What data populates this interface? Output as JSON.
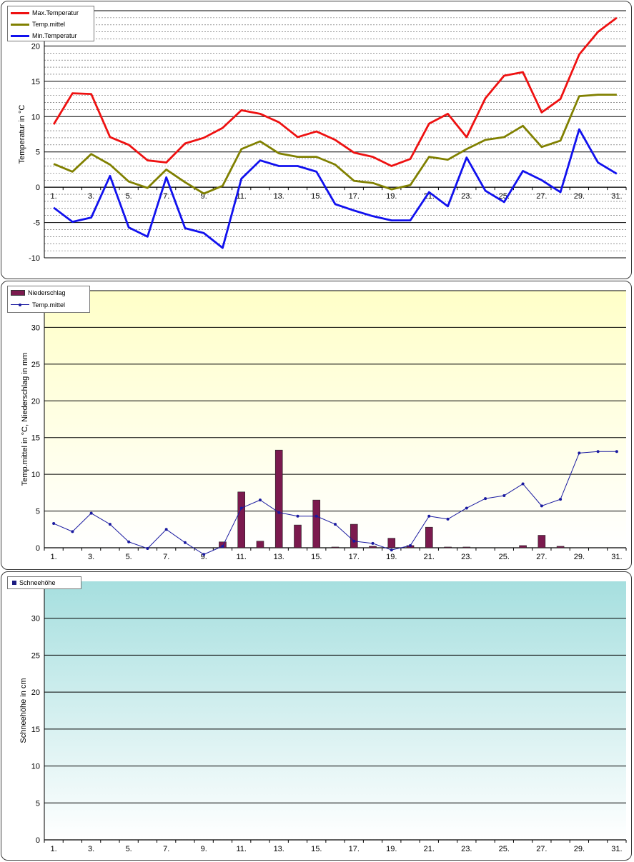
{
  "charts": [
    {
      "type": "line",
      "ylabel": "Temperatur  in °C",
      "ylim": [
        -10,
        25
      ],
      "yticks": [
        -10,
        -5,
        0,
        5,
        10,
        15,
        20
      ],
      "x_tick_labels": [
        "1.",
        "3.",
        "5.",
        "7.",
        "9.",
        "11.",
        "13.",
        "15.",
        "17.",
        "19.",
        "21.",
        "23.",
        "25.",
        "27.",
        "29.",
        "31."
      ],
      "legend": [
        "Max.Temperatur",
        "Temp.mittel",
        "Min.Temperatur"
      ]
    },
    {
      "type": "bar",
      "ylabel": "Temp.mittel  in °C, Niederschlag in mm",
      "ylim": [
        0,
        35
      ],
      "yticks": [
        0,
        5,
        10,
        15,
        20,
        25,
        30
      ],
      "x_tick_labels": [
        "1.",
        "3.",
        "5.",
        "7.",
        "9.",
        "11.",
        "13.",
        "15.",
        "17.",
        "19.",
        "21.",
        "23.",
        "25.",
        "27.",
        "29.",
        "31."
      ],
      "legend": [
        "Niederschlag",
        "Temp.mittel"
      ]
    },
    {
      "type": "bar",
      "ylabel": "Schneehöhe in cm",
      "ylim": [
        0,
        35
      ],
      "yticks": [
        0,
        5,
        10,
        15,
        20,
        25,
        30
      ],
      "x_tick_labels": [
        "1.",
        "3.",
        "5.",
        "7.",
        "9.",
        "11.",
        "13.",
        "15.",
        "17.",
        "19.",
        "21.",
        "23.",
        "25.",
        "27.",
        "29.",
        "31."
      ],
      "legend": [
        "Schneehöhe"
      ]
    }
  ],
  "chart_data": [
    {
      "type": "line",
      "x": [
        1,
        2,
        3,
        4,
        5,
        6,
        7,
        8,
        9,
        10,
        11,
        12,
        13,
        14,
        15,
        16,
        17,
        18,
        19,
        20,
        21,
        22,
        23,
        24,
        25,
        26,
        27,
        28,
        29,
        30,
        31
      ],
      "series": [
        {
          "name": "Max.Temperatur",
          "color": "#ee1111",
          "values": [
            8.9,
            13.3,
            13.2,
            7.1,
            6.0,
            3.8,
            3.5,
            6.2,
            7.0,
            8.4,
            10.9,
            10.4,
            9.2,
            7.1,
            7.9,
            6.7,
            4.9,
            4.3,
            3.0,
            4.0,
            9.0,
            10.4,
            7.1,
            12.6,
            15.8,
            16.3,
            10.6,
            12.5,
            18.8,
            22.0,
            24.0
          ]
        },
        {
          "name": "Temp.mittel",
          "color": "#808000",
          "values": [
            3.3,
            2.2,
            4.7,
            3.2,
            0.8,
            -0.1,
            2.5,
            0.7,
            -0.9,
            0.2,
            5.4,
            6.5,
            4.8,
            4.3,
            4.3,
            3.2,
            0.9,
            0.6,
            -0.3,
            0.3,
            4.3,
            3.9,
            5.4,
            6.7,
            7.1,
            8.7,
            5.7,
            6.6,
            12.9,
            13.1,
            13.1
          ]
        },
        {
          "name": "Min.Temperatur",
          "color": "#1111ee",
          "values": [
            -2.9,
            -4.9,
            -4.3,
            1.6,
            -5.7,
            -7.0,
            1.4,
            -5.8,
            -6.5,
            -8.6,
            1.2,
            3.8,
            3.0,
            3.0,
            2.2,
            -2.4,
            -3.3,
            -4.1,
            -4.7,
            -4.7,
            -0.7,
            -2.7,
            4.2,
            -0.5,
            -2.1,
            2.3,
            1.0,
            -0.7,
            8.2,
            3.5,
            1.9
          ]
        }
      ]
    },
    {
      "type": "bar",
      "x": [
        1,
        2,
        3,
        4,
        5,
        6,
        7,
        8,
        9,
        10,
        11,
        12,
        13,
        14,
        15,
        16,
        17,
        18,
        19,
        20,
        21,
        22,
        23,
        24,
        25,
        26,
        27,
        28,
        29,
        30,
        31
      ],
      "series": [
        {
          "name": "Niederschlag",
          "type": "bar",
          "color": "#7b1a4e",
          "values": [
            0,
            0,
            0,
            0,
            0,
            0,
            0,
            0,
            0,
            0.8,
            7.6,
            0.9,
            13.3,
            3.1,
            6.5,
            0.1,
            3.2,
            0.2,
            1.3,
            0.3,
            2.8,
            0.1,
            0.1,
            0,
            0,
            0.3,
            1.7,
            0.2,
            0,
            0,
            0
          ]
        },
        {
          "name": "Temp.mittel",
          "type": "line",
          "color": "#1a1aa0",
          "values": [
            3.3,
            2.2,
            4.7,
            3.2,
            0.8,
            -0.1,
            2.5,
            0.7,
            -0.9,
            0.2,
            5.4,
            6.5,
            4.8,
            4.3,
            4.3,
            3.2,
            0.9,
            0.6,
            -0.3,
            0.3,
            4.3,
            3.9,
            5.4,
            6.7,
            7.1,
            8.7,
            5.7,
            6.6,
            12.9,
            13.1,
            13.1
          ]
        }
      ]
    },
    {
      "type": "bar",
      "x": [
        1,
        2,
        3,
        4,
        5,
        6,
        7,
        8,
        9,
        10,
        11,
        12,
        13,
        14,
        15,
        16,
        17,
        18,
        19,
        20,
        21,
        22,
        23,
        24,
        25,
        26,
        27,
        28,
        29,
        30,
        31
      ],
      "series": [
        {
          "name": "Schneehöhe",
          "color": "#1a1a80",
          "values": [
            0,
            0,
            0,
            0,
            0,
            0,
            0,
            0,
            0,
            0,
            0,
            0,
            0,
            0,
            0,
            0,
            0,
            0,
            0,
            0,
            0,
            0,
            0,
            0,
            0,
            0,
            0,
            0,
            0,
            0,
            0
          ]
        }
      ]
    }
  ]
}
